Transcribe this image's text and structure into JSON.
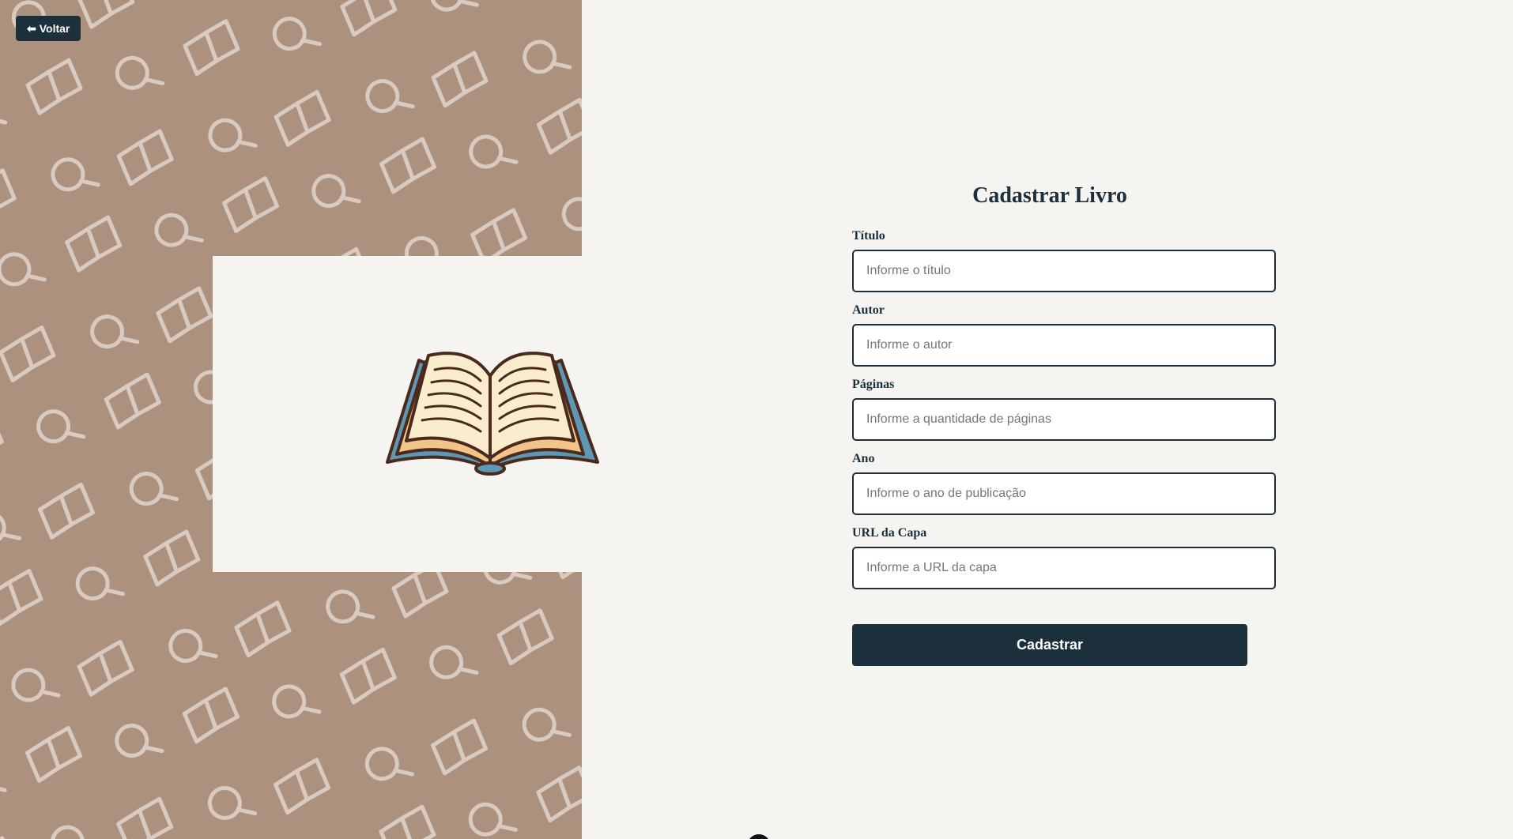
{
  "nav": {
    "back_label": "Voltar",
    "back_icon": "arrow-left-icon"
  },
  "form": {
    "title": "Cadastrar Livro",
    "fields": [
      {
        "label": "Título",
        "placeholder": "Informe o título"
      },
      {
        "label": "Autor",
        "placeholder": "Informe o autor"
      },
      {
        "label": "Páginas",
        "placeholder": "Informe a quantidade de páginas"
      },
      {
        "label": "Ano",
        "placeholder": "Informe o ano de publicação"
      },
      {
        "label": "URL da Capa",
        "placeholder": "Informe a URL da capa"
      }
    ],
    "submit_label": "Cadastrar"
  },
  "decor": {
    "pattern_icons": [
      "open-book-icon",
      "magnifier-icon"
    ],
    "illustration": "open-book-icon"
  },
  "colors": {
    "primary": "#1b303a",
    "panel_bg": "#ac917e",
    "page_bg": "#f6f4f1",
    "pattern_stroke": "#d9cbc1"
  }
}
